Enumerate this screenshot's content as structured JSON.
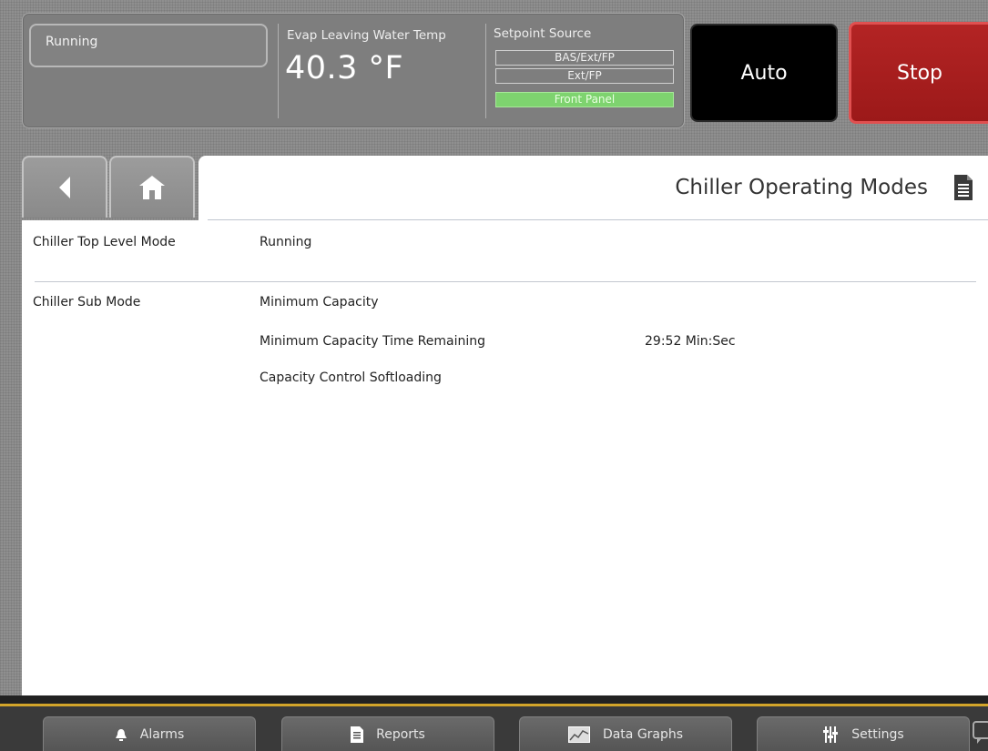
{
  "header": {
    "status": "Running",
    "temp_label": "Evap Leaving Water Temp",
    "temp_value": "40.3 °F",
    "setpoint_label": "Setpoint Source",
    "setpoint_options": [
      "BAS/Ext/FP",
      "Ext/FP",
      "Front Panel"
    ],
    "setpoint_active": "Front Panel",
    "auto_label": "Auto",
    "stop_label": "Stop"
  },
  "nav": {
    "back_icon": "back-arrow-icon",
    "home_icon": "home-icon"
  },
  "page": {
    "title": "Chiller Operating Modes",
    "title_icon": "document-icon"
  },
  "rows": [
    {
      "label": "Chiller Top Level Mode",
      "value": "Running"
    },
    {
      "label": "Chiller Sub Mode",
      "items": [
        {
          "text": "Minimum Capacity",
          "value": ""
        },
        {
          "text": "Minimum Capacity Time Remaining",
          "value": "29:52 Min:Sec"
        },
        {
          "text": "Capacity Control Softloading",
          "value": ""
        }
      ]
    }
  ],
  "tabs": [
    {
      "label": "Alarms",
      "icon": "bell-icon"
    },
    {
      "label": "Reports",
      "icon": "report-icon"
    },
    {
      "label": "Data Graphs",
      "icon": "graph-icon"
    },
    {
      "label": "Settings",
      "icon": "sliders-icon"
    }
  ],
  "colors": {
    "stop": "#a81e1e",
    "auto": "#000000",
    "active_setpoint": "#7ed36f",
    "accent_stripe": "#d3a52a"
  }
}
